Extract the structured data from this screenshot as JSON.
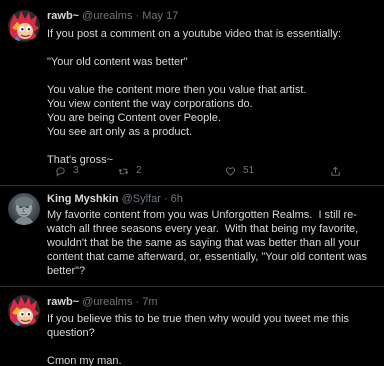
{
  "colors": {
    "background": "#000000",
    "text": "#d9d9d9",
    "muted": "#6e767d",
    "divider": "#2f3336"
  },
  "tweets": [
    {
      "display_name": "rawb~",
      "handle": "@urealms",
      "separator": "·",
      "time": "May 17",
      "avatar_icon": "cartoon-avatar-icon",
      "body": "If you post a comment on a youtube video that is essentially:\n\n\"Your old content was better\"\n\nYou value the content more then you value that artist.\nYou view content the way corporations do.\nYou are being Content over People.\nYou see art only as a product.\n\nThat's gross~",
      "actions": {
        "reply_icon": "reply-icon",
        "reply_count": "3",
        "retweet_icon": "retweet-icon",
        "retweet_count": "2",
        "like_icon": "heart-icon",
        "like_count": "51",
        "share_icon": "share-icon"
      }
    },
    {
      "display_name": "King Myshkin",
      "handle": "@Sylfar",
      "separator": "·",
      "time": "6h",
      "avatar_icon": "bust-avatar-icon",
      "body": "My favorite content from you was Unforgotten Realms.  I still re-watch all three seasons every year.  With that being my favorite, wouldn't that be the same as saying that was better than all your content that came afterward, or, essentially, \"Your old content was better\"?"
    },
    {
      "display_name": "rawb~",
      "handle": "@urealms",
      "separator": "·",
      "time": "7m",
      "avatar_icon": "cartoon-avatar-icon",
      "body": "If you believe this to be true then why would you tweet me this question?\n\nCmon my man."
    }
  ]
}
